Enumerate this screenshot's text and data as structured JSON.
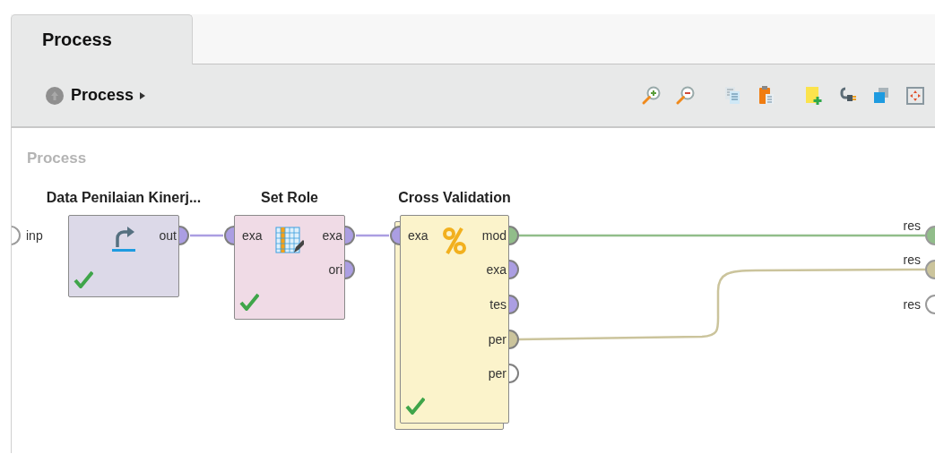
{
  "tabs": [
    {
      "label": "Process",
      "selected": true
    }
  ],
  "breadcrumb": {
    "label": "Process"
  },
  "canvas": {
    "title": "Process",
    "inputs": [
      {
        "label": "inp",
        "color": "#ffffff"
      }
    ],
    "operators": [
      {
        "name": "Data Penilaian Kinerj...",
        "kind": "retrieve",
        "color": "#dcd9e8",
        "executed": true,
        "outputs": [
          {
            "label": "out",
            "color": "#ab9ee2"
          }
        ]
      },
      {
        "name": "Set Role",
        "kind": "set-role",
        "color": "#f0dbe6",
        "executed": true,
        "inputs": [
          {
            "label": "exa",
            "color": "#ab9ee2"
          }
        ],
        "outputs": [
          {
            "label": "exa",
            "color": "#ab9ee2"
          },
          {
            "label": "ori",
            "color": "#ab9ee2"
          }
        ]
      },
      {
        "name": "Cross Validation",
        "kind": "subprocess",
        "color": "#fbf3cb",
        "executed": true,
        "inputs": [
          {
            "label": "exa",
            "color": "#ab9ee2"
          }
        ],
        "outputs": [
          {
            "label": "mod",
            "color": "#91bd8a"
          },
          {
            "label": "exa",
            "color": "#ab9ee2"
          },
          {
            "label": "tes",
            "color": "#ab9ee2"
          },
          {
            "label": "per",
            "color": "#cbc49c"
          },
          {
            "label": "per",
            "color": "#ffffff"
          }
        ]
      }
    ],
    "outputs": [
      {
        "label": "res",
        "color": "#91bd8a"
      },
      {
        "label": "res",
        "color": "#cbc49c"
      },
      {
        "label": "res",
        "color": "#ffffff"
      }
    ]
  }
}
